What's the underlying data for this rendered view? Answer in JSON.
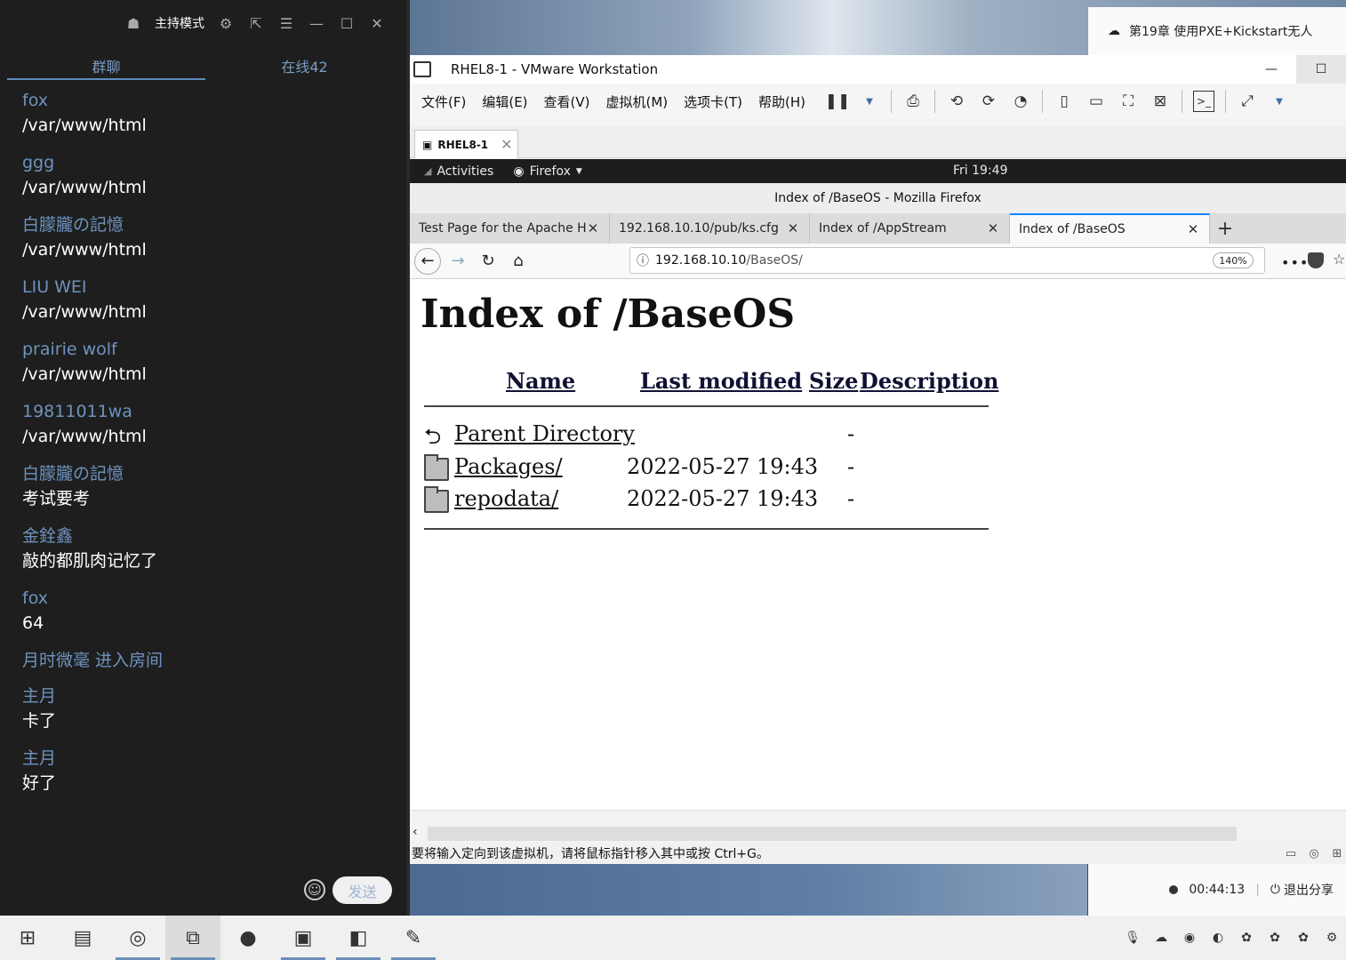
{
  "chat": {
    "title": "主持模式",
    "tabs": {
      "group": "群聊",
      "online": "在线42"
    },
    "messages": [
      {
        "nick": "fox",
        "body": "/var/www/html"
      },
      {
        "nick": "ggg",
        "body": "/var/www/html"
      },
      {
        "nick": "白朦朧の記憶",
        "body": "/var/www/html"
      },
      {
        "nick": "LIU WEI",
        "body": "/var/www/html"
      },
      {
        "nick": "prairie wolf",
        "body": "/var/www/html"
      },
      {
        "nick": "19811011wa",
        "body": "/var/www/html"
      },
      {
        "nick": "白朦朧の記憶",
        "body": "考试要考"
      },
      {
        "nick": "金銓鑫",
        "body": "敲的都肌肉记忆了"
      },
      {
        "nick": "fox",
        "body": "64"
      },
      {
        "nick": "月时微毫 进入房间",
        "body": ""
      },
      {
        "nick": "主月",
        "body": "卡了"
      },
      {
        "nick": "主月",
        "body": "好了"
      }
    ],
    "send_label": "发送"
  },
  "notification": {
    "text": "第19章 使用PXE+Kickstart无人"
  },
  "share": {
    "timer": "00:44:13",
    "exit_label": "退出分享"
  },
  "vmware": {
    "title": "RHEL8-1 - VMware Workstation",
    "menu": [
      "文件(F)",
      "编辑(E)",
      "查看(V)",
      "虚拟机(M)",
      "选项卡(T)",
      "帮助(H)"
    ],
    "vm_tab": "RHEL8-1",
    "status": "要将输入定向到该虚拟机，请将鼠标指针移入其中或按 Ctrl+G。"
  },
  "gnome": {
    "activities": "Activities",
    "app": "Firefox",
    "clock": "Fri 19:49"
  },
  "firefox": {
    "window_title": "Index of /BaseOS - Mozilla Firefox",
    "tabs": [
      {
        "label": "Test Page for the Apache HT",
        "active": false
      },
      {
        "label": "192.168.10.10/pub/ks.cfg",
        "active": false
      },
      {
        "label": "Index of /AppStream",
        "active": false
      },
      {
        "label": "Index of /BaseOS",
        "active": true
      }
    ],
    "url_host": "192.168.10.10",
    "url_path": "/BaseOS/",
    "zoom": "140%"
  },
  "page": {
    "heading": "Index of /BaseOS",
    "columns": {
      "name": "Name",
      "modified": "Last modified",
      "size": "Size",
      "description": "Description"
    },
    "rows": [
      {
        "name": "Parent Directory",
        "modified": "",
        "size": "-",
        "icon": "back-icon"
      },
      {
        "name": "Packages/",
        "modified": "2022-05-27 19:43",
        "size": "-",
        "icon": "folder-icon"
      },
      {
        "name": "repodata/",
        "modified": "2022-05-27 19:43",
        "size": "-",
        "icon": "folder-icon"
      }
    ]
  }
}
